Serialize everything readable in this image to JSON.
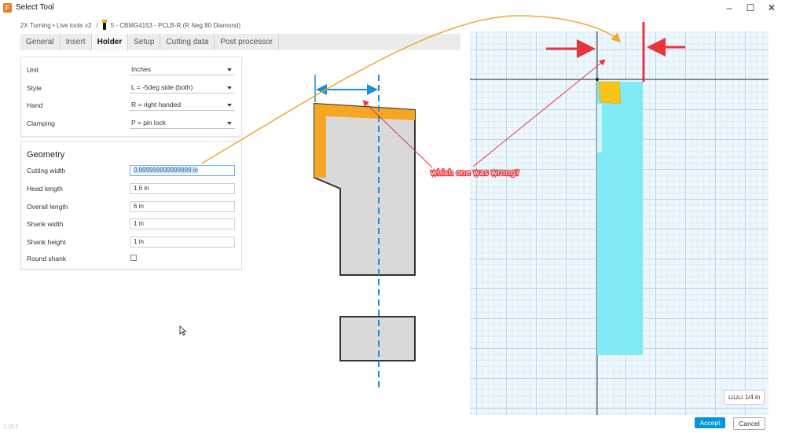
{
  "window": {
    "title": "Select Tool",
    "app_icon_letter": "F",
    "controls": [
      "–",
      "☐",
      "✕"
    ]
  },
  "breadcrumb": {
    "library": "2X Turning • Live tools v2",
    "separator": "/",
    "tool": "5 - CBMG4153 - PCLB-R (R Neg 80 Diamond)"
  },
  "tabs": [
    "General",
    "Insert",
    "Holder",
    "Setup",
    "Cutting data",
    "Post processor"
  ],
  "active_tab": "Holder",
  "holder_settings": [
    {
      "label": "Unit",
      "value": "Inches"
    },
    {
      "label": "Style",
      "value": "L = -5deg side (both)"
    },
    {
      "label": "Hand",
      "value": "R = right handed"
    },
    {
      "label": "Clamping",
      "value": "P = pin lock"
    }
  ],
  "geometry": {
    "title": "Geometry",
    "fields": [
      {
        "label": "Cutting width",
        "value": "0.999999999999999 in"
      },
      {
        "label": "Head length",
        "value": "1.6 in"
      },
      {
        "label": "Overall length",
        "value": "6 in"
      },
      {
        "label": "Shank width",
        "value": "1 in"
      },
      {
        "label": "Shank height",
        "value": "1 in"
      }
    ],
    "round_shank_label": "Round shank",
    "round_shank_checked": false
  },
  "annotation": {
    "text": "which one was wrong?",
    "color": "#e8343a"
  },
  "preview": {
    "scale_label": "1/4 in"
  },
  "buttons": {
    "accept": "Accept",
    "cancel": "Cancel"
  },
  "colors": {
    "accent": "#0696d7",
    "insert_orange": "#f5a623",
    "holder_fill": "#d9d9d9",
    "preview_cyan": "#80eaf7",
    "arrow_red": "#e8343a",
    "curve_orange": "#f0a830",
    "dimension_blue": "#1a8fd8"
  },
  "version": "1.15.2"
}
